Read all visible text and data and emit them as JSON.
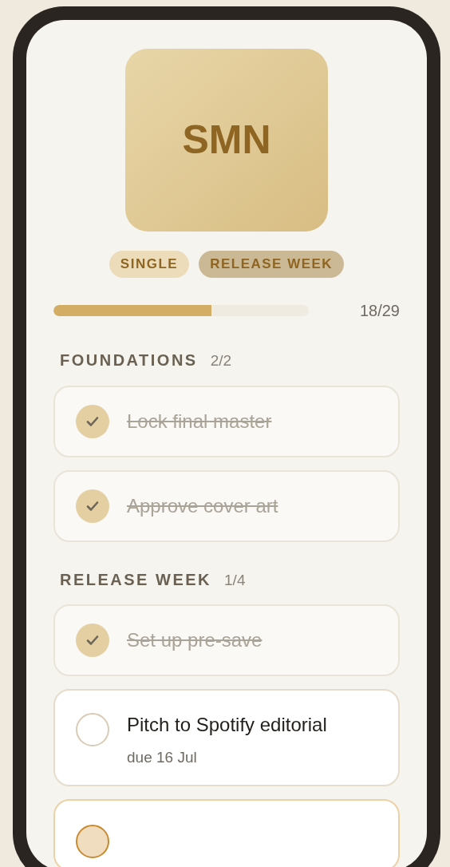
{
  "cover": {
    "initials": "SMN"
  },
  "tags": [
    {
      "label": "SINGLE",
      "selected": false
    },
    {
      "label": "RELEASE WEEK",
      "selected": true
    }
  ],
  "progress": {
    "level": 0.62,
    "count": "18/29"
  },
  "sections": [
    {
      "title": "FOUNDATIONS",
      "count": "2/2",
      "tasks": [
        {
          "title": "Lock final master",
          "kind": "done"
        },
        {
          "title": "Approve cover art",
          "kind": "done"
        }
      ]
    },
    {
      "title": "RELEASE WEEK",
      "count": "1/4",
      "tasks": [
        {
          "title": "Set up pre-save",
          "kind": "done"
        },
        {
          "title": "Pitch to Spotify editorial",
          "due": "due 16 Jul",
          "kind": "todo"
        },
        {
          "kind": "active"
        }
      ]
    }
  ]
}
